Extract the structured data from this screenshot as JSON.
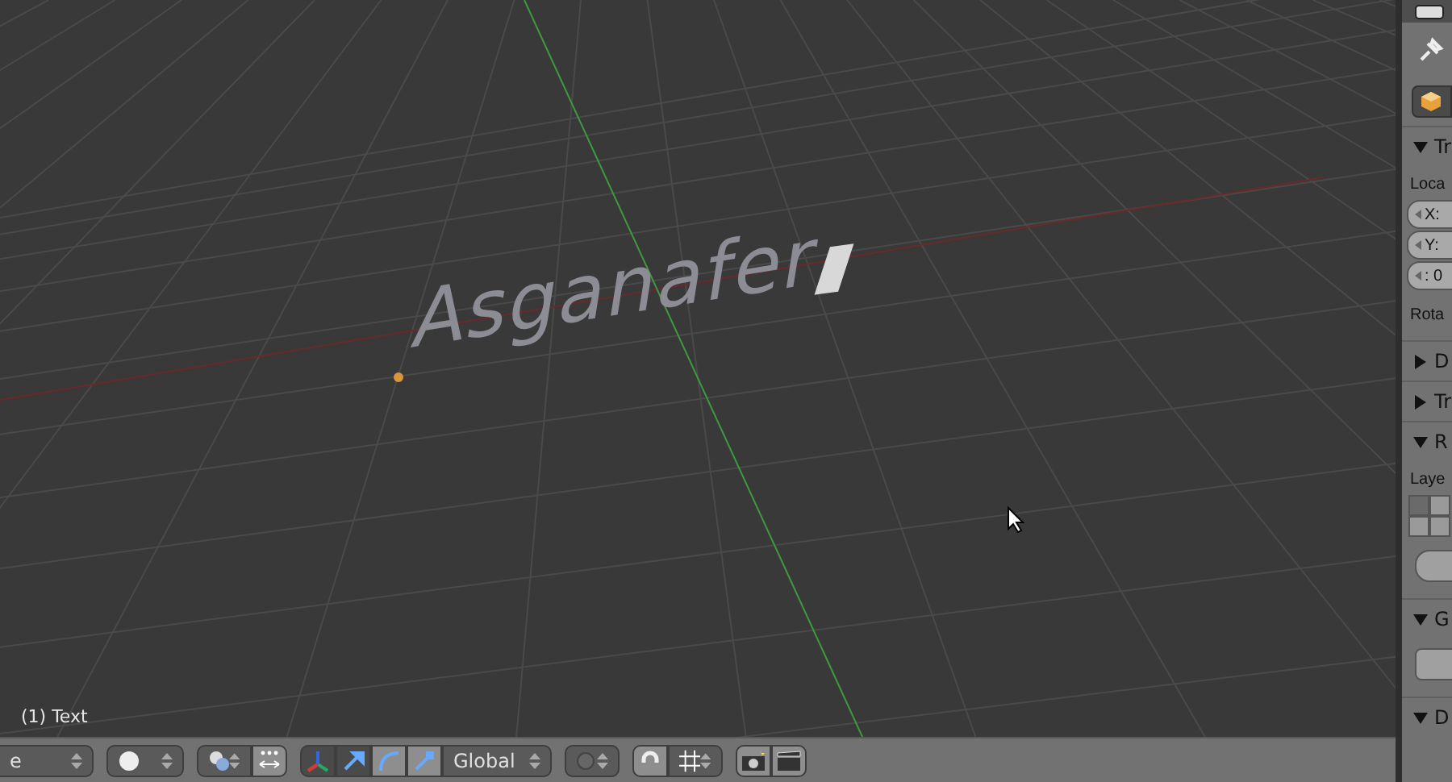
{
  "viewport": {
    "object_text": "Asganafer",
    "status": "(1) Text"
  },
  "properties_panel": {
    "panels": [
      {
        "title": "Tr",
        "expanded": true,
        "kind": "transform",
        "label": "Loca",
        "fields": [
          "X:",
          "Y:",
          ": 0"
        ],
        "sublabel": "Rota"
      },
      {
        "title": "D",
        "expanded": false
      },
      {
        "title": "Tr",
        "expanded": false
      },
      {
        "title": "R",
        "expanded": true,
        "kind": "relations",
        "label": "Laye",
        "layers": [
          {
            "selected": true
          },
          {
            "selected": false
          },
          {
            "selected": false
          },
          {
            "selected": false
          }
        ]
      },
      {
        "title": "G",
        "expanded": true,
        "kind": "groups"
      },
      {
        "title": "D",
        "expanded": true
      }
    ]
  },
  "header": {
    "mode": "e",
    "manipulators": [
      {
        "kind": "toggle",
        "selected": true
      },
      {
        "kind": "translate",
        "selected": true
      },
      {
        "kind": "rotate",
        "selected": false
      },
      {
        "kind": "scale",
        "selected": false
      }
    ],
    "orientation": "Global"
  }
}
